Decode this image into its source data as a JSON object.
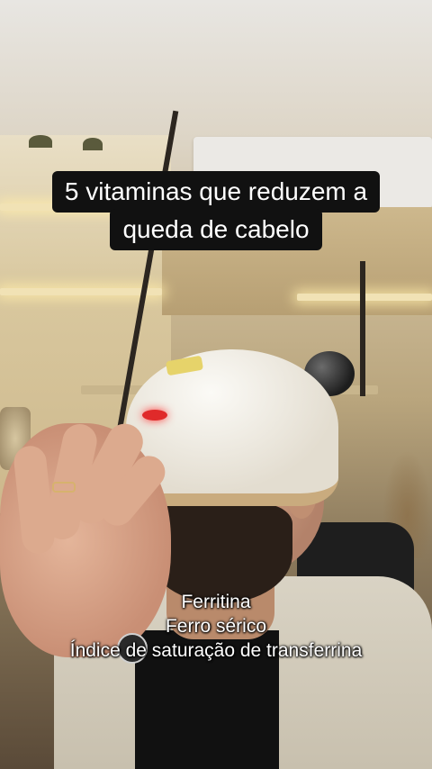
{
  "headline": {
    "line1": "5 vitaminas que reduzem a",
    "line2": "queda de cabelo"
  },
  "caption": {
    "line1": "Ferritina",
    "line2": "Ferro sérico",
    "line3": "Índice de saturação de transferrina"
  }
}
